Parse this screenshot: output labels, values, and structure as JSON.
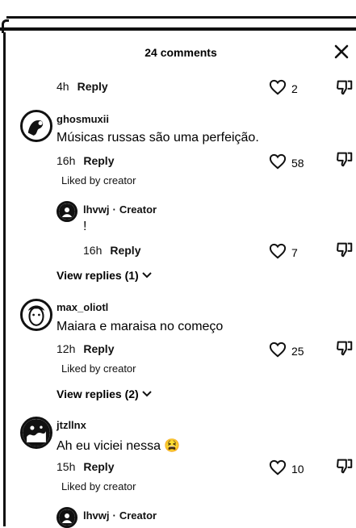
{
  "header": {
    "title": "24 comments"
  },
  "top_row": {
    "time": "4h",
    "reply": "Reply",
    "likes": "2"
  },
  "comments": [
    {
      "username": "ghosmuxii",
      "text": "Músicas russas são uma perfeição.",
      "time": "16h",
      "reply": "Reply",
      "likes": "58",
      "liked_by_creator": "Liked by creator"
    },
    {
      "username": "max_oliotl",
      "text": "Maiara e maraisa no começo",
      "time": "12h",
      "reply": "Reply",
      "likes": "25",
      "liked_by_creator": "Liked by creator",
      "view_replies": "View replies (2)"
    },
    {
      "username": "jtzllnx",
      "text": "Ah eu viciei nessa 😫",
      "time": "15h",
      "reply": "Reply",
      "likes": "10",
      "liked_by_creator": "Liked by creator"
    }
  ],
  "creator_reply_1": {
    "username": "lhvwj",
    "role": "Creator",
    "separator": "·",
    "text": "!",
    "time": "16h",
    "reply": "Reply",
    "likes": "7",
    "view_replies": "View replies (1)"
  },
  "creator_reply_2": {
    "username": "lhvwj",
    "role": "Creator",
    "separator": "·"
  },
  "icons": {
    "close": "close-icon",
    "like": "heart-icon",
    "dislike": "thumbs-down-icon",
    "chevron": "chevron-down-icon"
  }
}
